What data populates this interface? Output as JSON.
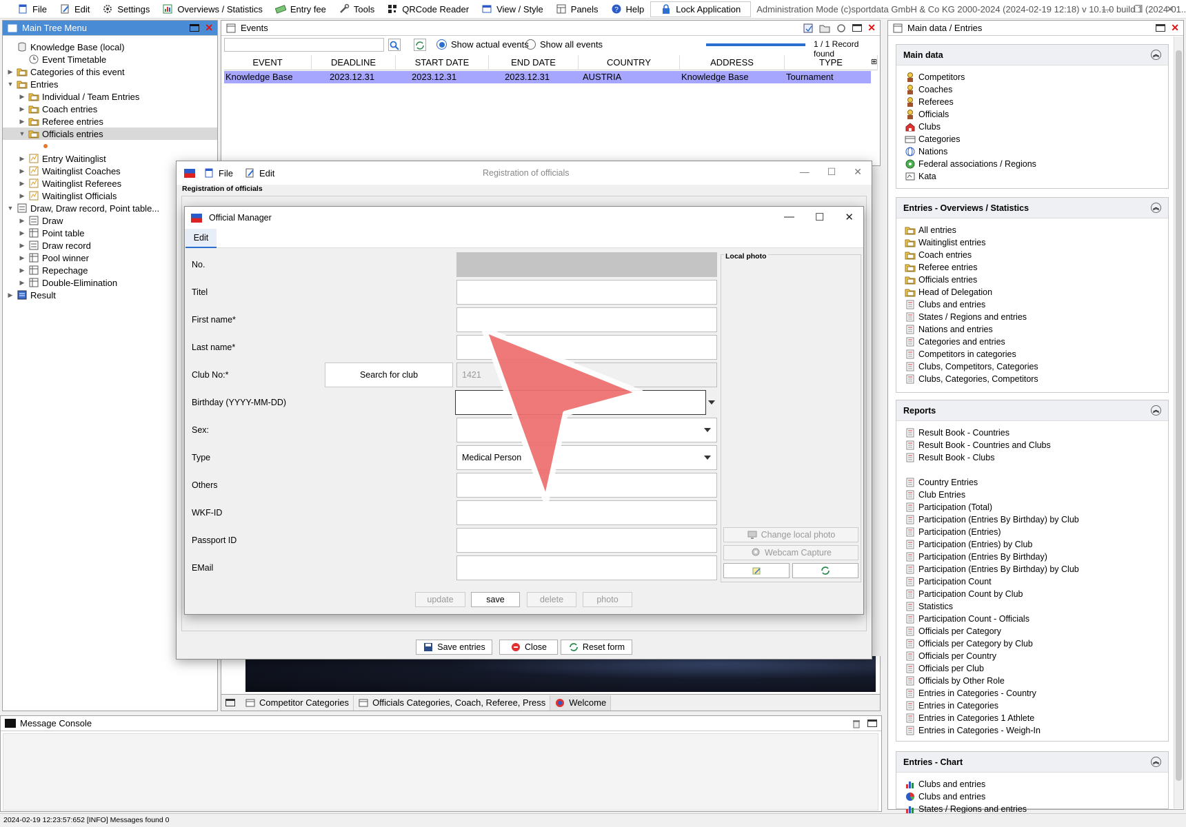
{
  "menubar": {
    "items": [
      {
        "label": "File",
        "icon": "file-icon"
      },
      {
        "label": "Edit",
        "icon": "edit-icon"
      },
      {
        "label": "Settings",
        "icon": "gear-icon"
      },
      {
        "label": "Overviews / Statistics",
        "icon": "overview-icon"
      },
      {
        "label": "Entry fee",
        "icon": "money-icon"
      },
      {
        "label": "Tools",
        "icon": "wrench-icon"
      },
      {
        "label": "QRCode Reader",
        "icon": "qrcode-icon"
      },
      {
        "label": "View / Style",
        "icon": "view-icon"
      },
      {
        "label": "Panels",
        "icon": "panels-icon"
      },
      {
        "label": "Help",
        "icon": "help-icon"
      }
    ],
    "lock_label": "Lock Application",
    "admin_text": "Administration Mode (c)sportdata GmbH & Co KG 2000-2024 (2024-02-19 12:18)  v 10.1.0 build 1 (2024-01..."
  },
  "tree": {
    "title": "Main Tree Menu",
    "items": [
      {
        "label": "Knowledge Base (local)",
        "level": 0,
        "tw": "",
        "icon": "db-icon"
      },
      {
        "label": "Event Timetable",
        "level": 1,
        "tw": "",
        "icon": "clock-icon"
      },
      {
        "label": "Categories of this event",
        "level": 0,
        "tw": "▶",
        "icon": "folder-icon"
      },
      {
        "label": "Entries",
        "level": 0,
        "tw": "▼",
        "icon": "folder-icon"
      },
      {
        "label": "Individual / Team Entries",
        "level": 1,
        "tw": "▶",
        "icon": "folder-icon"
      },
      {
        "label": "Coach entries",
        "level": 1,
        "tw": "▶",
        "icon": "folder-icon"
      },
      {
        "label": "Referee entries",
        "level": 1,
        "tw": "▶",
        "icon": "folder-icon"
      },
      {
        "label": "Officials entries",
        "level": 1,
        "tw": "▼",
        "icon": "folder-icon",
        "selected": true
      },
      {
        "label": "",
        "level": 2,
        "tw": "",
        "icon": "dot-icon"
      },
      {
        "label": "Entry Waitinglist",
        "level": 1,
        "tw": "▶",
        "icon": "list-icon"
      },
      {
        "label": "Waitinglist Coaches",
        "level": 1,
        "tw": "▶",
        "icon": "list-icon"
      },
      {
        "label": "Waitinglist Referees",
        "level": 1,
        "tw": "▶",
        "icon": "list-icon"
      },
      {
        "label": "Waitinglist Officials",
        "level": 1,
        "tw": "▶",
        "icon": "list-icon"
      },
      {
        "label": "Draw, Draw record, Point table...",
        "level": 0,
        "tw": "▼",
        "icon": "draw-icon"
      },
      {
        "label": "Draw",
        "level": 1,
        "tw": "▶",
        "icon": "draw-icon"
      },
      {
        "label": "Point table",
        "level": 1,
        "tw": "▶",
        "icon": "table-icon"
      },
      {
        "label": "Draw record",
        "level": 1,
        "tw": "▶",
        "icon": "draw-icon"
      },
      {
        "label": "Pool winner",
        "level": 1,
        "tw": "▶",
        "icon": "table-icon"
      },
      {
        "label": "Repechage",
        "level": 1,
        "tw": "▶",
        "icon": "table-icon"
      },
      {
        "label": "Double-Elimination",
        "level": 1,
        "tw": "▶",
        "icon": "table-icon"
      },
      {
        "label": "Result",
        "level": 0,
        "tw": "▶",
        "icon": "result-icon"
      }
    ]
  },
  "events": {
    "title": "Events",
    "search_value": "",
    "show_actual_label": "Show actual events",
    "show_all_label": "Show all events",
    "record_count": "1 / 1 Record found",
    "columns": [
      "EVENT",
      "DEADLINE",
      "START DATE",
      "END DATE",
      "COUNTRY",
      "ADDRESS",
      "TYPE"
    ],
    "rows": [
      [
        "Knowledge Base",
        "2023.12.31",
        "2023.12.31",
        "2023.12.31",
        "AUSTRIA",
        "Knowledge Base",
        "Tournament"
      ]
    ]
  },
  "bottom_tabs": [
    "Competitor Categories",
    "Officials Categories, Coach, Referee, Press",
    "Welcome"
  ],
  "right_panel": {
    "title": "Main data / Entries",
    "sections": [
      {
        "title": "Main data",
        "items": [
          "Competitors",
          "Coaches",
          "Referees",
          "Officials",
          "Clubs",
          "Categories",
          "Nations",
          "Federal associations / Regions",
          "Kata"
        ]
      },
      {
        "title": "Entries - Overviews / Statistics",
        "items": [
          "All entries",
          "Waitinglist entries",
          "Coach entries",
          "Referee entries",
          "Officials entries",
          "Head of Delegation",
          "Clubs and entries",
          "States / Regions and entries",
          "Nations and entries",
          "Categories and entries",
          "Competitors in categories",
          "Clubs, Competitors, Categories",
          "Clubs, Categories, Competitors"
        ]
      },
      {
        "title": "Reports",
        "items": [
          "Result Book - Countries",
          "Result Book - Countries and Clubs",
          "Result Book - Clubs",
          "",
          "Country Entries",
          "Club Entries",
          "Participation (Total)",
          "Participation (Entries By Birthday) by Club",
          "Participation (Entries)",
          "Participation (Entries) by Club",
          "Participation (Entries By Birthday)",
          "Participation (Entries By Birthday) by Club",
          "Participation Count",
          "Participation Count by Club",
          "Statistics",
          "Participation Count - Officials",
          "Officials per Category",
          "Officials per Category by Club",
          "Officials per Country",
          "Officials per Club",
          "Officials by Other Role",
          "Entries in Categories - Country",
          "Entries in Categories",
          "Entries in Categories 1 Athlete",
          "Entries in Categories - Weigh-In"
        ]
      },
      {
        "title": "Entries - Chart",
        "items": [
          "Clubs and entries",
          "Clubs and entries",
          "States / Regions and entries"
        ]
      }
    ]
  },
  "console": {
    "title": "Message Console",
    "status": "2024-02-19 12:23:57:652 [INFO] Messages found 0"
  },
  "registration": {
    "menu_file": "File",
    "menu_edit": "Edit",
    "title": "Registration of officials",
    "group_label": "Registration of officials",
    "save_label": "Save entries",
    "close_label": "Close",
    "reset_label": "Reset form"
  },
  "manager": {
    "title": "Official Manager",
    "tab_edit": "Edit",
    "local_photo": "Local photo",
    "fields": {
      "no": {
        "label": "No.",
        "value": ""
      },
      "titel": {
        "label": "Titel",
        "value": ""
      },
      "first_name": {
        "label": "First name*",
        "value": ""
      },
      "last_name": {
        "label": "Last name*",
        "value": ""
      },
      "club_no": {
        "label": "Club No:*",
        "value": "1421"
      },
      "birthday": {
        "label": "Birthday (YYYY-MM-DD)",
        "value": ""
      },
      "sex": {
        "label": "Sex:",
        "value": ""
      },
      "type": {
        "label": "Type",
        "value": "Medical Person"
      },
      "others": {
        "label": "Others",
        "value": ""
      },
      "wkf_id": {
        "label": "WKF-ID",
        "value": ""
      },
      "passport": {
        "label": "Passport ID",
        "value": ""
      },
      "email": {
        "label": "EMail",
        "value": ""
      }
    },
    "search_club_label": "Search for club",
    "change_photo_label": "Change local photo",
    "webcam_label": "Webcam Capture",
    "update_label": "update",
    "save_label": "save",
    "delete_label": "delete",
    "photo_label": "photo"
  },
  "colors": {
    "accent": "#4a8bd6",
    "row_selected": "#a6a6ff",
    "pointer": "#ee6e6e"
  }
}
